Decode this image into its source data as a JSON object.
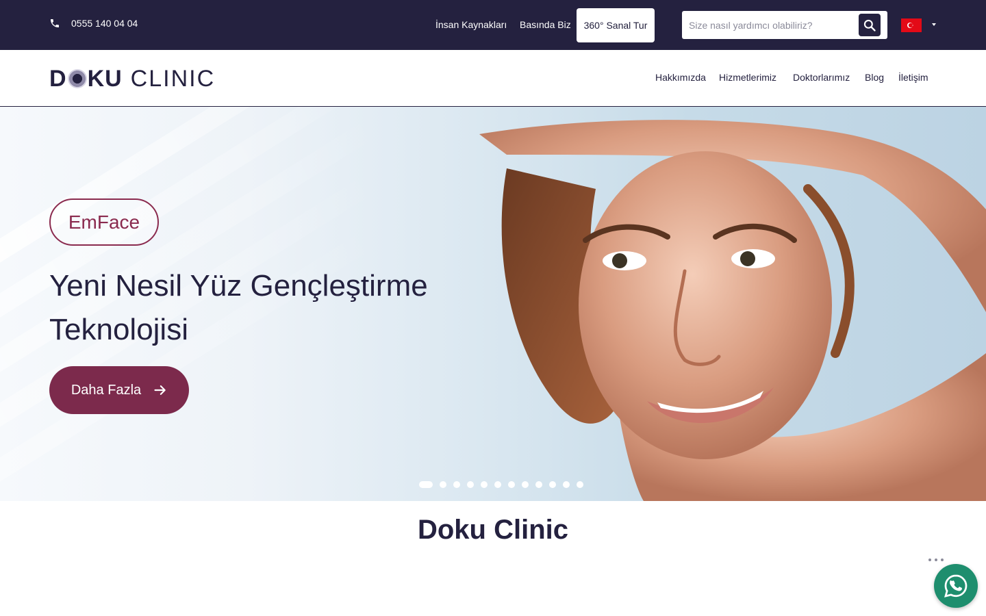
{
  "topbar": {
    "phone": "0555 140 04 04",
    "links": [
      "İnsan Kaynakları",
      "Basında Biz"
    ],
    "tour_button": "360° Sanal Tur",
    "search_placeholder": "Size nasıl yardımcı olabiliriz?",
    "language_flag": "turkey-flag-icon"
  },
  "header": {
    "logo_primary": "DOKU",
    "logo_secondary": "CLINIC",
    "nav": [
      "Hakkımızda",
      "Hizmetlerimiz",
      "Doktorlarımız",
      "Blog",
      "İletişim"
    ]
  },
  "hero": {
    "tag": "EmFace",
    "headline": "Yeni Nesil Yüz Gençleştirme Teknolojisi",
    "cta_label": "Daha Fazla",
    "slide_count": 12,
    "active_slide": 1
  },
  "section": {
    "title": "Doku Clinic"
  },
  "colors": {
    "dark": "#24213f",
    "accent": "#7c2a4c",
    "whatsapp": "#1e8e6e"
  }
}
